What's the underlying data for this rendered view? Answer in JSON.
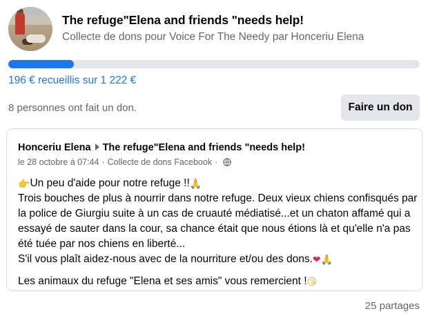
{
  "fundraiser": {
    "title": "The refuge\"Elena and friends \"needs help!",
    "subtitle": "Collecte de dons pour Voice For The Needy par Honceriu Elena",
    "progress_fraction": 0.16,
    "raised_text": "196 € recueillis sur 1 222 €",
    "donors_text": "8 personnes ont fait un don.",
    "donate_label": "Faire un don"
  },
  "post": {
    "author": "Honceriu Elena",
    "target": "The refuge\"Elena and friends \"needs help!",
    "date": "le 28 octobre à 07:44",
    "source": "Collecte de dons Facebook",
    "privacy_icon": "globe-icon",
    "line1": "Un peu d'aide pour notre refuge !!",
    "line2": "Trois bouches de plus à nourrir dans notre refuge. Deux vieux chiens confisqués par la police de Giurgiu suite à un cas de cruauté médiatisé...et un chaton affamé qui a essayé de sauter dans la cour, sa chance était que nous étions là et qu'elle n'a pas été tuée par nos chiens en liberté...",
    "line3": "S'il vous plaît aidez-nous avec de la nourriture et/ou des dons.",
    "line4": "Les animaux du refuge \"Elena et ses amis\" vous remercient !",
    "emojis": {
      "point": "👉",
      "pray": "🙏",
      "heart": "❤",
      "kiss": "😘"
    }
  },
  "shares_text": "25 partages",
  "colors": {
    "accent": "#1877f2",
    "secondary_text": "#65676b",
    "button_bg": "#e4e6eb"
  }
}
